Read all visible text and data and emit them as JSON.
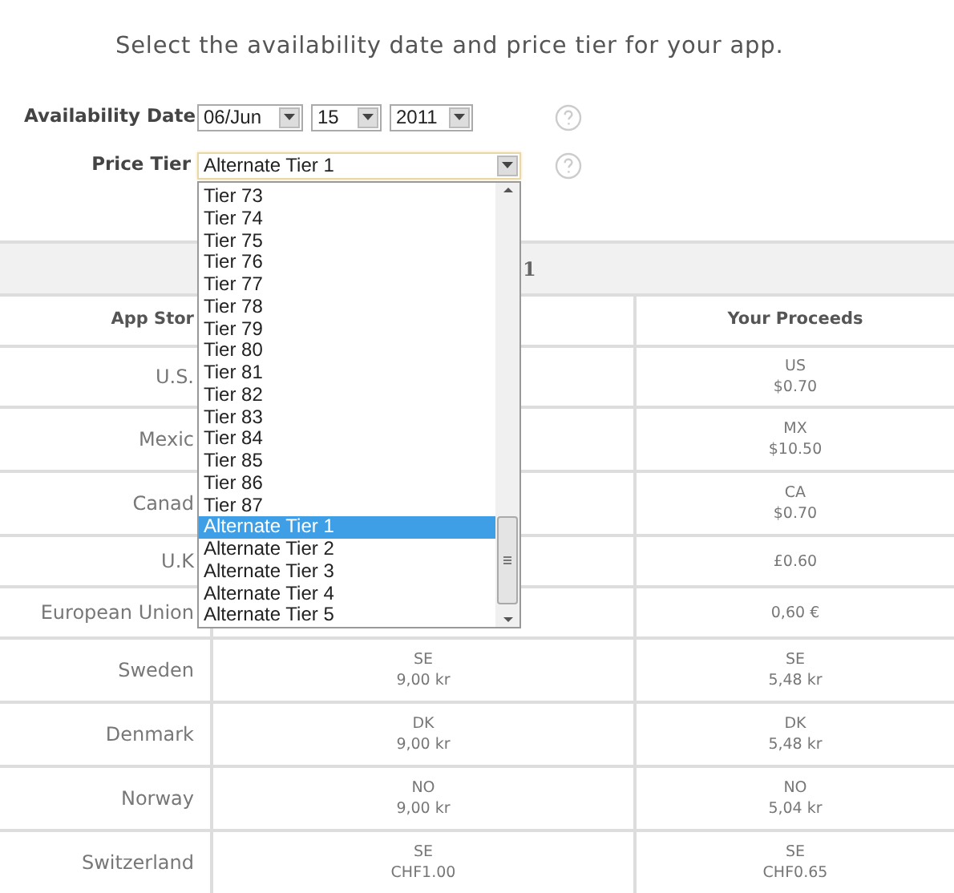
{
  "heading": "Select the availability date and price tier for your app.",
  "availability_date": {
    "label": "Availability Date",
    "fields": [
      {
        "value": "06/Jun"
      },
      {
        "value": "15"
      },
      {
        "value": "2011"
      }
    ]
  },
  "price_tier": {
    "label": "Price Tier",
    "value": "Alternate Tier 1",
    "expanded": true,
    "options": [
      {
        "label": "Tier 73",
        "selected": false
      },
      {
        "label": "Tier 74",
        "selected": false
      },
      {
        "label": "Tier 75",
        "selected": false
      },
      {
        "label": "Tier 76",
        "selected": false
      },
      {
        "label": "Tier 77",
        "selected": false
      },
      {
        "label": "Tier 78",
        "selected": false
      },
      {
        "label": "Tier 79",
        "selected": false
      },
      {
        "label": "Tier 80",
        "selected": false
      },
      {
        "label": "Tier 81",
        "selected": false
      },
      {
        "label": "Tier 82",
        "selected": false
      },
      {
        "label": "Tier 83",
        "selected": false
      },
      {
        "label": "Tier 84",
        "selected": false
      },
      {
        "label": "Tier 85",
        "selected": false
      },
      {
        "label": "Tier 86",
        "selected": false
      },
      {
        "label": "Tier 87",
        "selected": false
      },
      {
        "label": "Alternate Tier 1",
        "selected": true
      },
      {
        "label": "Alternate Tier 2",
        "selected": false
      },
      {
        "label": "Alternate Tier 3",
        "selected": false
      },
      {
        "label": "Alternate Tier 4",
        "selected": false
      },
      {
        "label": "Alternate Tier 5",
        "selected": false
      }
    ]
  },
  "table": {
    "title": "1",
    "columns": {
      "app_store": "App Stor",
      "proceeds": "Your Proceeds"
    },
    "rows": [
      {
        "store": "U.S.",
        "proceeds": [
          "US",
          "$0.70"
        ]
      },
      {
        "store": "Mexic",
        "proceeds": [
          "MX",
          "$10.50"
        ]
      },
      {
        "store": "Canad",
        "proceeds": [
          "CA",
          "$0.70"
        ]
      },
      {
        "store": "U.K",
        "proceeds": [
          "£0.60"
        ]
      },
      {
        "store": "European Union",
        "proceeds": [
          "0,60 €"
        ]
      },
      {
        "store": "Sweden",
        "price": [
          "SE",
          "9,00 kr"
        ],
        "proceeds": [
          "SE",
          "5,48 kr"
        ]
      },
      {
        "store": "Denmark",
        "price": [
          "DK",
          "9,00 kr"
        ],
        "proceeds": [
          "DK",
          "5,48 kr"
        ]
      },
      {
        "store": "Norway",
        "price": [
          "NO",
          "9,00 kr"
        ],
        "proceeds": [
          "NO",
          "5,04 kr"
        ]
      },
      {
        "store": "Switzerland",
        "price": [
          "SE",
          "CHF1.00"
        ],
        "proceeds": [
          "SE",
          "CHF0.65"
        ]
      }
    ]
  }
}
